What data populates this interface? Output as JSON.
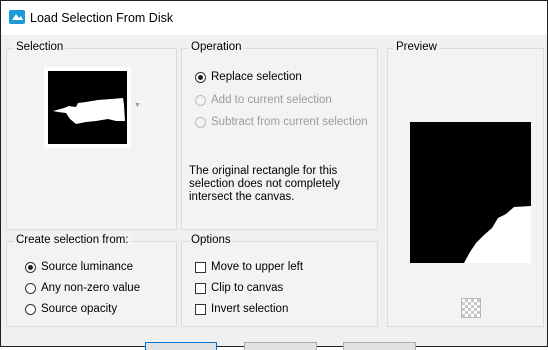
{
  "window": {
    "title": "Load Selection From Disk"
  },
  "selection_panel": {
    "legend": "Selection"
  },
  "operation": {
    "legend": "Operation",
    "options": [
      {
        "label": "Replace selection",
        "checked": true,
        "enabled": true
      },
      {
        "label": "Add to current selection",
        "checked": false,
        "enabled": false
      },
      {
        "label": "Subtract from current selection",
        "checked": false,
        "enabled": false
      }
    ],
    "note": "The original rectangle for this selection does not completely intersect the canvas."
  },
  "preview": {
    "legend": "Preview"
  },
  "create_from": {
    "legend": "Create selection from:",
    "options": [
      {
        "label": "Source luminance",
        "checked": true
      },
      {
        "label": "Any non-zero value",
        "checked": false
      },
      {
        "label": "Source opacity",
        "checked": false
      }
    ]
  },
  "options": {
    "legend": "Options",
    "items": [
      {
        "label": "Move to upper left",
        "checked": false
      },
      {
        "label": "Clip to canvas",
        "checked": false
      },
      {
        "label": "Invert selection",
        "checked": false
      }
    ]
  },
  "colors": {
    "accent": "#0078d7",
    "panel_bg": "#f3f3f3",
    "icon_blue": "#1e9ad6"
  }
}
